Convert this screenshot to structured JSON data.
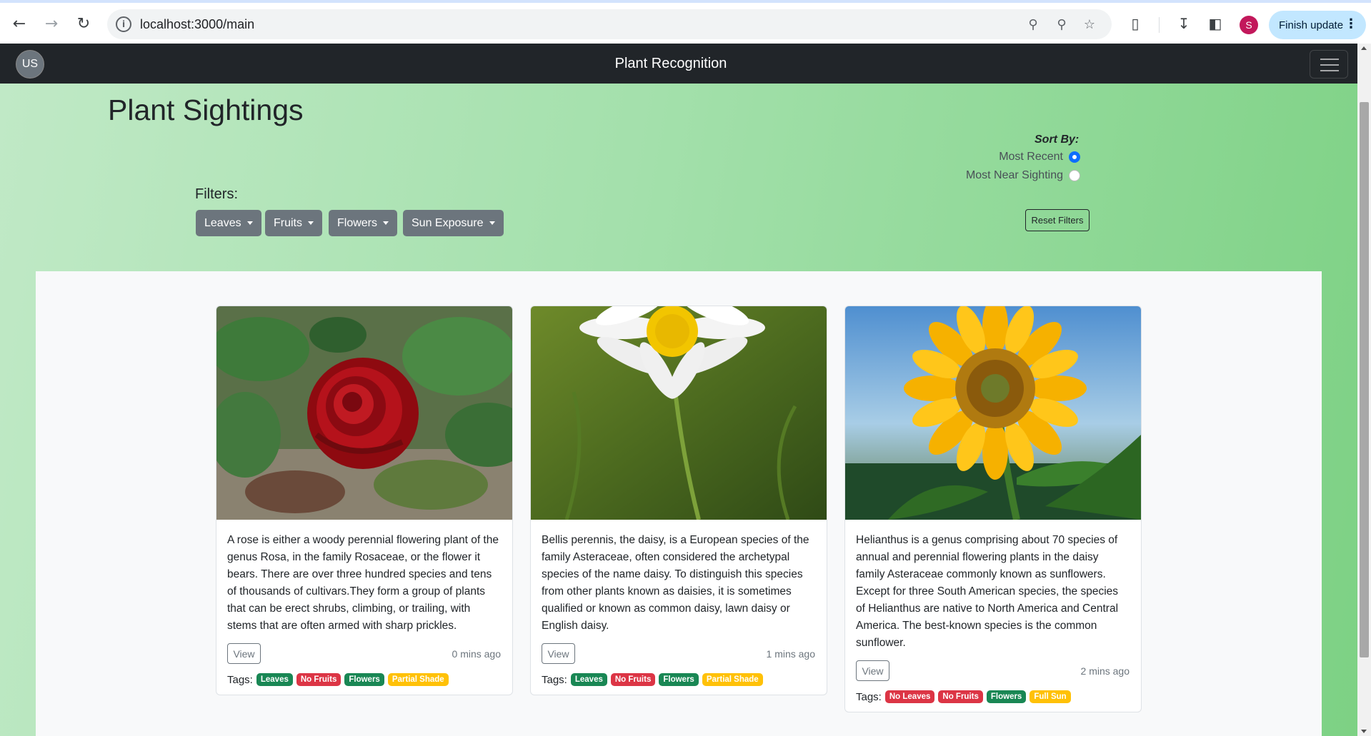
{
  "browser": {
    "url": "localhost:3000/main",
    "profile_initial": "S",
    "finish_update_label": "Finish update"
  },
  "navbar": {
    "avatar_initials": "US",
    "brand": "Plant Recognition"
  },
  "page": {
    "title": "Plant Sightings",
    "filters_label": "Filters:",
    "filters": [
      "Leaves",
      "Fruits",
      "Flowers",
      "Sun Exposure"
    ],
    "sort_label": "Sort By:",
    "sort_options": [
      {
        "label": "Most Recent",
        "checked": true
      },
      {
        "label": "Most Near Sighting",
        "checked": false
      }
    ],
    "reset_label": "Reset Filters"
  },
  "cards": [
    {
      "image": "red-rose-photo",
      "description": "A rose is either a woody perennial flowering plant of the genus Rosa, in the family Rosaceae, or the flower it bears. There are over three hundred species and tens of thousands of cultivars.They form a group of plants that can be erect shrubs, climbing, or trailing, with stems that are often armed with sharp prickles.",
      "view_label": "View",
      "time_ago": "0 mins ago",
      "tags_label": "Tags:",
      "tags": [
        {
          "text": "Leaves",
          "color": "#198754"
        },
        {
          "text": "No Fruits",
          "color": "#dc3545"
        },
        {
          "text": "Flowers",
          "color": "#198754"
        },
        {
          "text": "Partial Shade",
          "color": "#ffc107"
        }
      ]
    },
    {
      "image": "daisy-photo",
      "description": "Bellis perennis, the daisy, is a European species of the family Asteraceae, often considered the archetypal species of the name daisy. To distinguish this species from other plants known as daisies, it is sometimes qualified or known as common daisy, lawn daisy or English daisy.",
      "view_label": "View",
      "time_ago": "1 mins ago",
      "tags_label": "Tags:",
      "tags": [
        {
          "text": "Leaves",
          "color": "#198754"
        },
        {
          "text": "No Fruits",
          "color": "#dc3545"
        },
        {
          "text": "Flowers",
          "color": "#198754"
        },
        {
          "text": "Partial Shade",
          "color": "#ffc107"
        }
      ]
    },
    {
      "image": "sunflower-photo",
      "description": "Helianthus is a genus comprising about 70 species of annual and perennial flowering plants in the daisy family Asteraceae commonly known as sunflowers. Except for three South American species, the species of Helianthus are native to North America and Central America. The best-known species is the common sunflower.",
      "view_label": "View",
      "time_ago": "2 mins ago",
      "tags_label": "Tags:",
      "tags": [
        {
          "text": "No Leaves",
          "color": "#dc3545"
        },
        {
          "text": "No Fruits",
          "color": "#dc3545"
        },
        {
          "text": "Flowers",
          "color": "#198754"
        },
        {
          "text": "Full Sun",
          "color": "#ffc107"
        }
      ]
    }
  ]
}
